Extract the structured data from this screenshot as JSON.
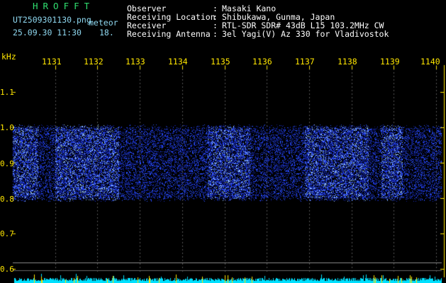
{
  "app": {
    "title": "HROFFT"
  },
  "file": {
    "name": "UT2509301130.png",
    "suffix": "meteor",
    "date_time": "25.09.30 11:30",
    "count": "18."
  },
  "info": [
    {
      "label": "Observer",
      "sep": ":",
      "value": "Masaki Kano"
    },
    {
      "label": "Receiving Location",
      "sep": ":",
      "value": "Shibukawa, Gunma, Japan"
    },
    {
      "label": "Receiver",
      "sep": ":",
      "value": "RTL-SDR SDR# 43dB L15 103.2MHz CW"
    },
    {
      "label": "Receiving Antenna",
      "sep": ":",
      "value": "3el Yagi(V) Az 330 for Vladivostok"
    }
  ],
  "axes": {
    "y_unit": "kHz",
    "y_ticks": [
      "1.1",
      "1.0",
      "0.9",
      "0.8",
      "0.7",
      "0.6"
    ],
    "x_ticks": [
      "1131",
      "1132",
      "1133",
      "1134",
      "1135",
      "1136",
      "1137",
      "1138",
      "1139",
      "1140"
    ]
  },
  "colors": {
    "accent_yellow": "#ffe600",
    "title_green": "#30e070",
    "signal_blue": "#2a50ff",
    "baseline_cyan": "#00e0ff"
  },
  "signal": {
    "freq_range_khz": [
      0.79,
      1.01
    ],
    "bright_segments_min": [
      [
        1130.0,
        1130.6
      ],
      [
        1131.0,
        1132.5
      ],
      [
        1134.6,
        1135.6
      ],
      [
        1136.9,
        1138.4
      ],
      [
        1138.7,
        1139.2
      ]
    ]
  }
}
